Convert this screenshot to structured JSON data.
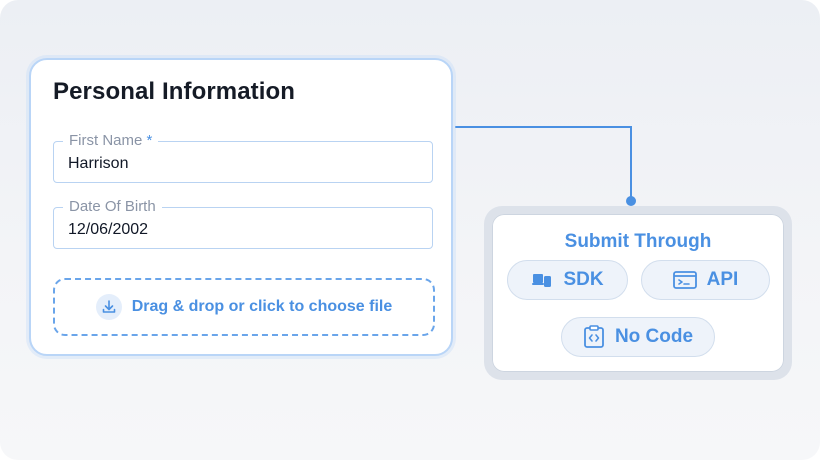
{
  "form": {
    "title": "Personal Information",
    "first_name": {
      "label": "First Name",
      "required_mark": "*",
      "value": "Harrison"
    },
    "date_of_birth": {
      "label": "Date Of Birth",
      "value": "12/06/2002"
    },
    "upload": {
      "label": "Drag & drop or click to choose file",
      "icon": "download-icon"
    }
  },
  "submit_panel": {
    "title": "Submit Through",
    "options": [
      {
        "label": "SDK",
        "icon": "devices-icon"
      },
      {
        "label": "API",
        "icon": "terminal-window-icon"
      },
      {
        "label": "No Code",
        "icon": "code-clipboard-icon"
      }
    ]
  },
  "colors": {
    "accent": "#4a90e2",
    "card_border": "#b9d5f7",
    "title_text": "#151b26",
    "field_label": "#8a94a6",
    "pill_background": "#eef3fa"
  }
}
